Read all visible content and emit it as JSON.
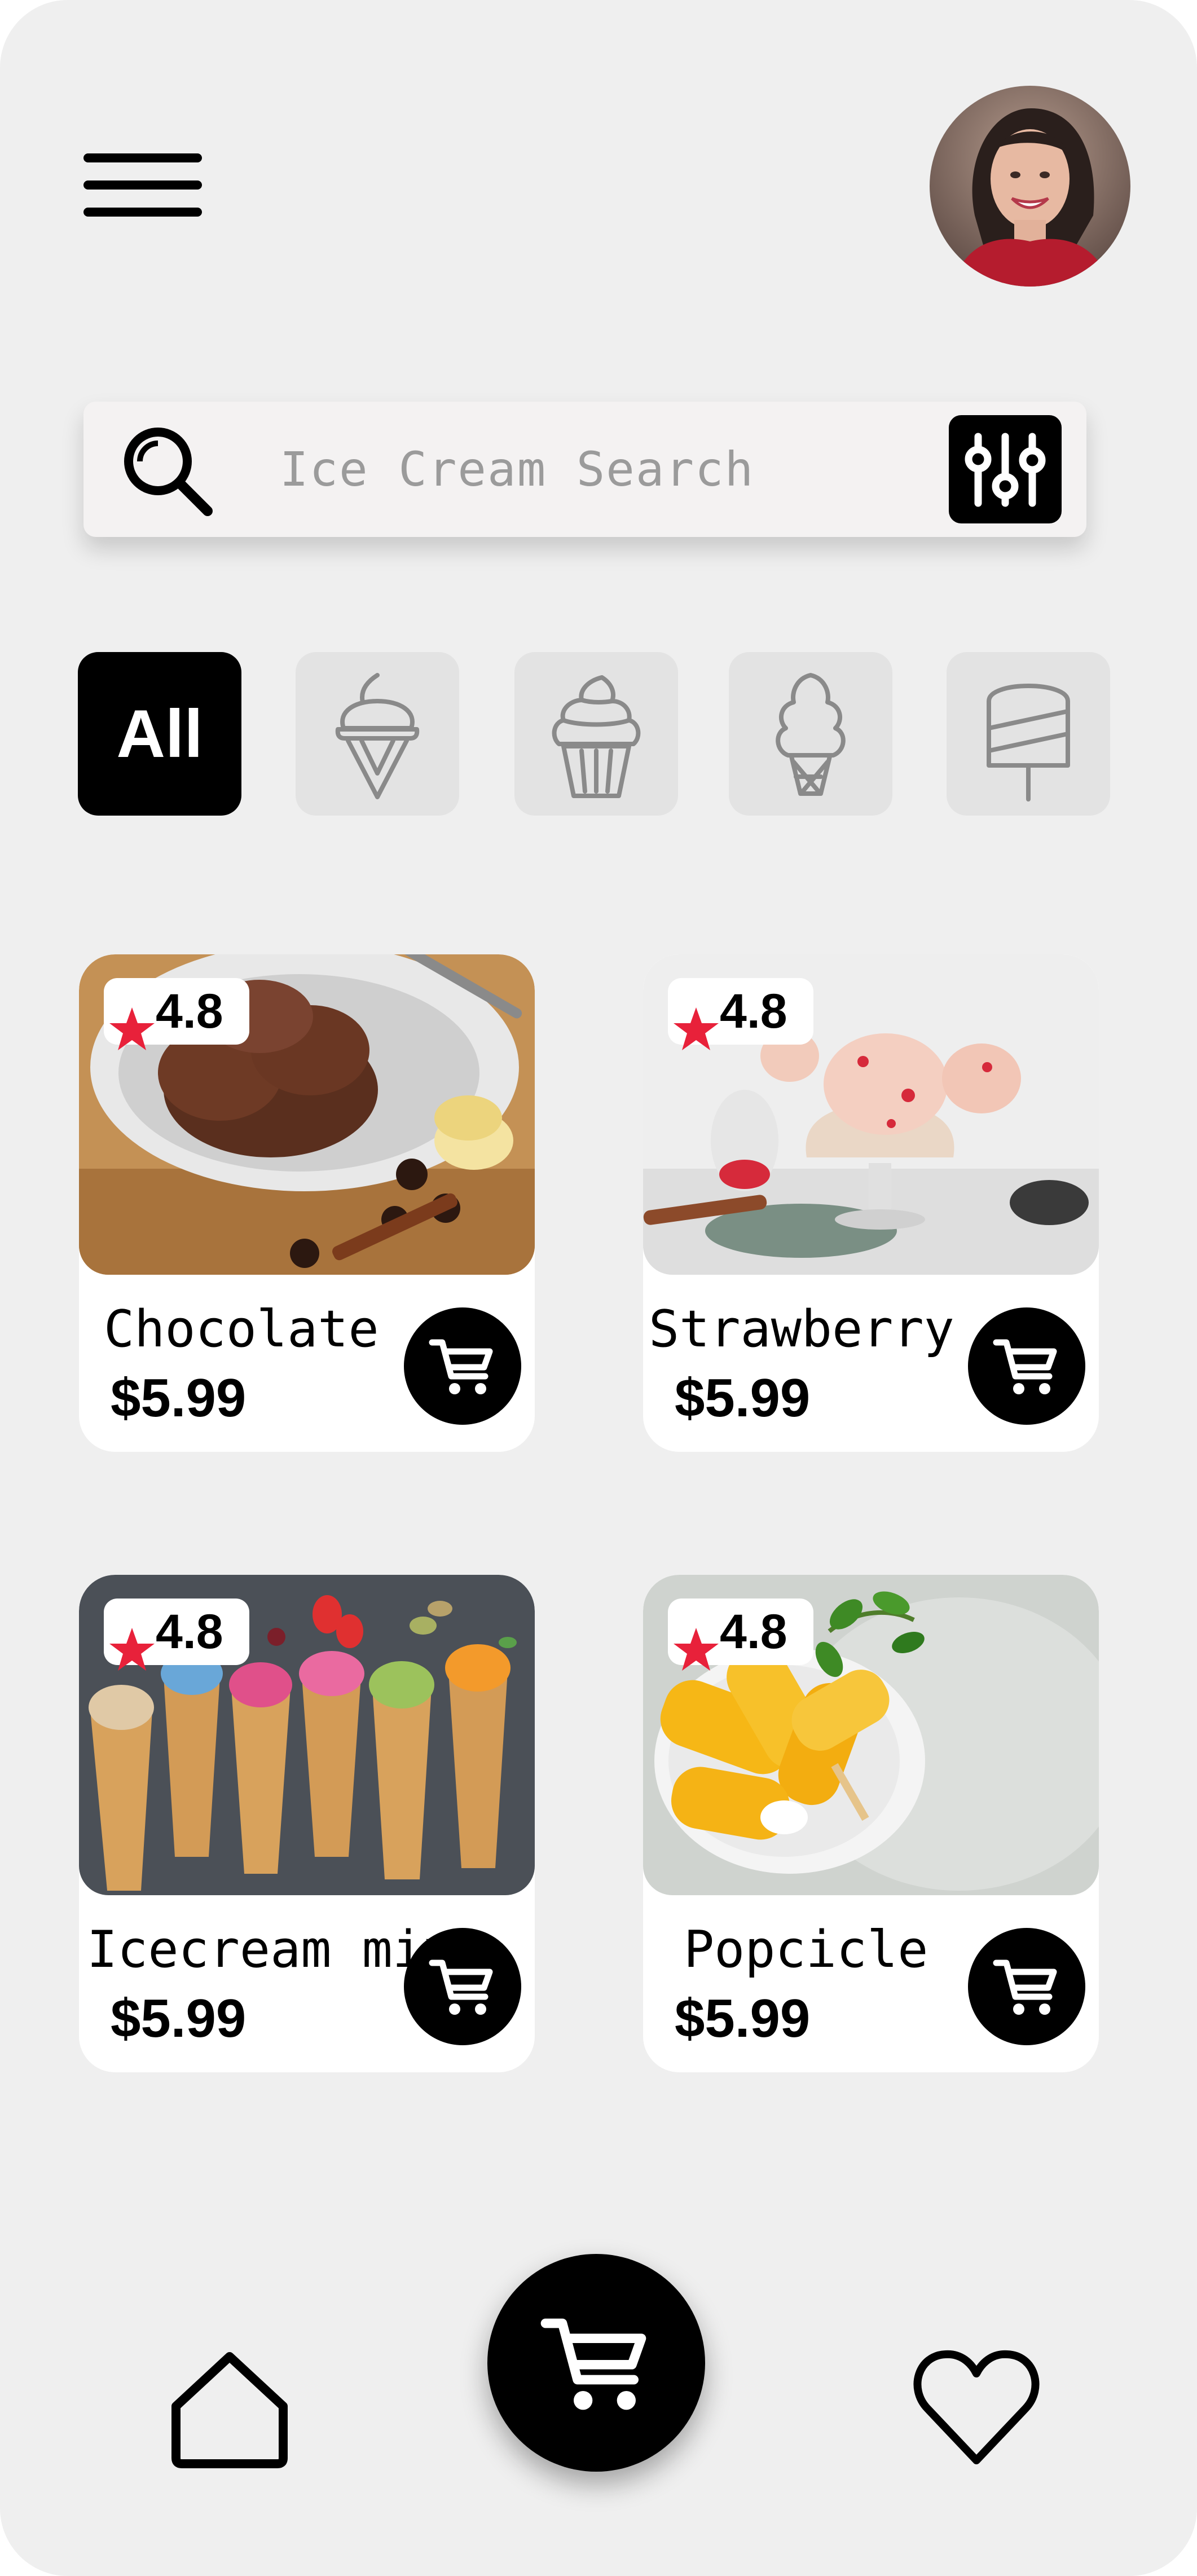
{
  "header": {
    "menu_icon": "hamburger-menu-icon",
    "avatar": "profile-photo-woman"
  },
  "search": {
    "placeholder": "Ice Cream Search",
    "icon": "search-icon",
    "filter_icon": "sliders-icon"
  },
  "categories": [
    {
      "label": "All",
      "active": true
    },
    {
      "icon": "soft-serve-cone-icon",
      "active": false
    },
    {
      "icon": "swirl-cup-icon",
      "active": false
    },
    {
      "icon": "waffle-cone-icon",
      "active": false
    },
    {
      "icon": "popsicle-icon",
      "active": false
    }
  ],
  "products": [
    {
      "name": "Chocolate",
      "price": "$5.99",
      "rating": "4.8"
    },
    {
      "name": "Strawberry",
      "price": "$5.99",
      "rating": "4.8"
    },
    {
      "name": "Icecream mix",
      "price": "$5.99",
      "rating": "4.8"
    },
    {
      "name": "Popcicle",
      "price": "$5.99",
      "rating": "4.8"
    }
  ],
  "bottom_nav": {
    "home_icon": "home-icon",
    "cart_icon": "cart-icon",
    "favorites_icon": "heart-icon"
  },
  "colors": {
    "background": "#efefef",
    "accent": "#000000",
    "rating_star": "#e8213a",
    "card": "#ffffff"
  }
}
